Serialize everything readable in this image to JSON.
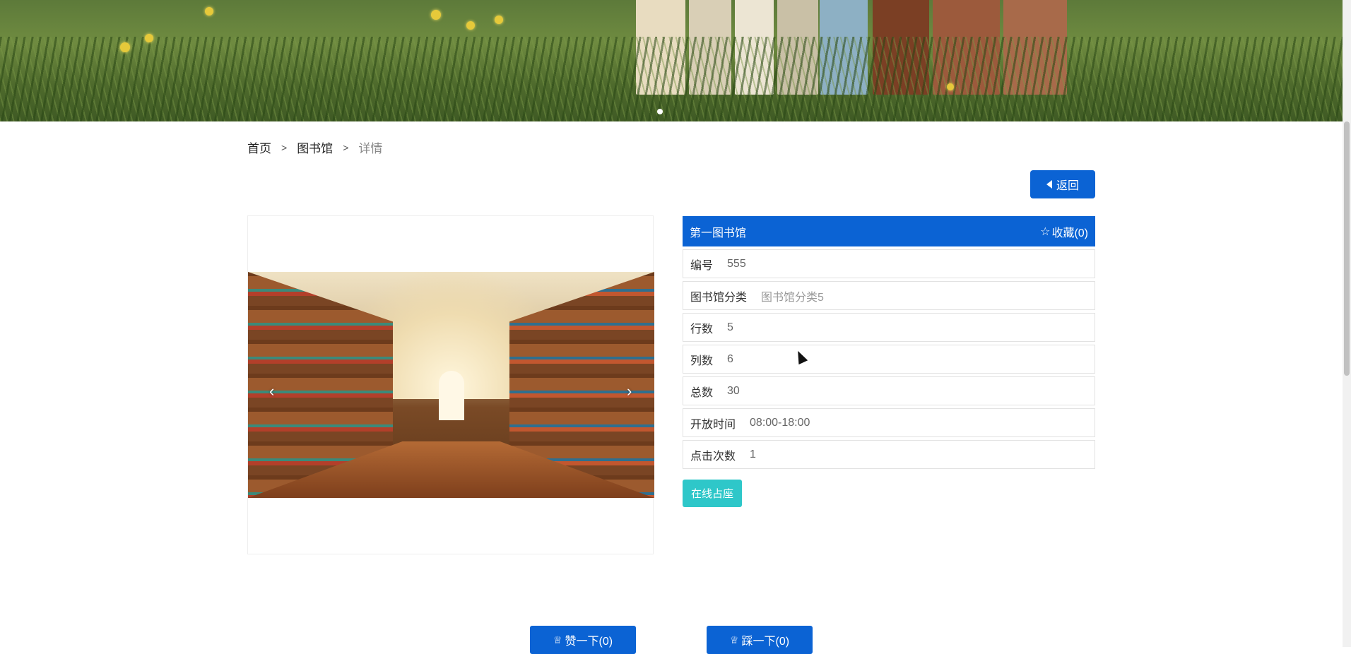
{
  "breadcrumb": {
    "home": "首页",
    "section": "图书馆",
    "current": "详情",
    "separator": ">"
  },
  "back_button": {
    "label": "返回"
  },
  "gallery": {
    "prev_arrow": "‹",
    "next_arrow": "›"
  },
  "details": {
    "title": "第一图书馆",
    "favorite_icon": "☆",
    "favorite_label": "收藏(0)",
    "fields": [
      {
        "label": "编号",
        "value": "555"
      },
      {
        "label": "图书馆分类",
        "value": "图书馆分类5"
      },
      {
        "label": "行数",
        "value": "5"
      },
      {
        "label": "列数",
        "value": "6"
      },
      {
        "label": "总数",
        "value": "30"
      },
      {
        "label": "开放时间",
        "value": "08:00-18:00"
      },
      {
        "label": "点击次数",
        "value": "1"
      }
    ]
  },
  "reserve_button": {
    "label": "在线占座"
  },
  "vote": {
    "like_icon": "♕",
    "like_label": "赞一下(0)",
    "dislike_icon": "♕",
    "dislike_label": "踩一下(0)"
  },
  "colors": {
    "primary": "#0b63d4",
    "accent": "#2ec7c9"
  }
}
